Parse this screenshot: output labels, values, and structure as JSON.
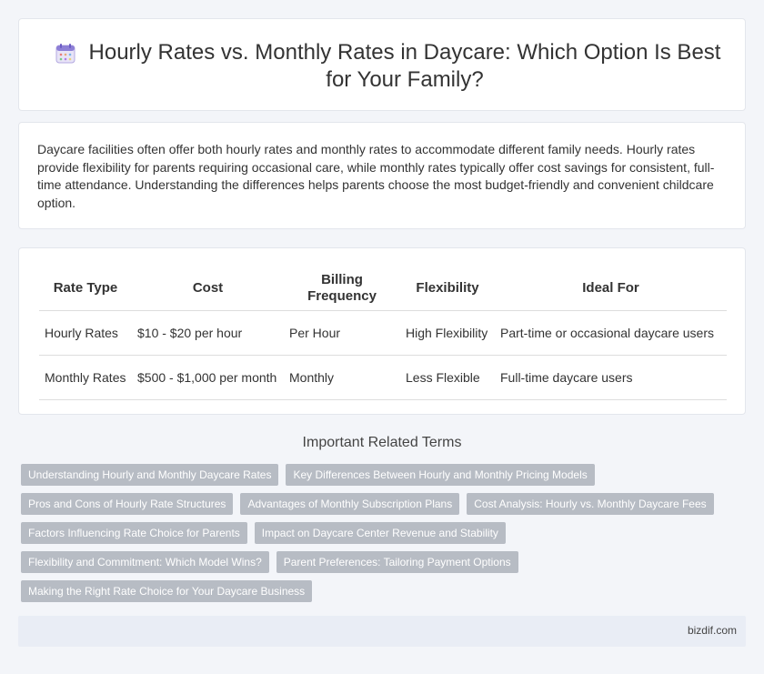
{
  "header": {
    "title": "Hourly Rates vs. Monthly Rates in Daycare: Which Option Is Best for Your Family?",
    "icon": "calendar-icon"
  },
  "intro": {
    "text": "Daycare facilities often offer both hourly rates and monthly rates to accommodate different family needs. Hourly rates provide flexibility for parents requiring occasional care, while monthly rates typically offer cost savings for consistent, full-time attendance. Understanding the differences helps parents choose the most budget-friendly and convenient childcare option."
  },
  "table": {
    "headers": [
      "Rate Type",
      "Cost",
      "Billing Frequency",
      "Flexibility",
      "Ideal For"
    ],
    "rows": [
      [
        "Hourly Rates",
        "$10 - $20 per hour",
        "Per Hour",
        "High Flexibility",
        "Part-time or occasional daycare users"
      ],
      [
        "Monthly Rates",
        "$500 - $1,000 per month",
        "Monthly",
        "Less Flexible",
        "Full-time daycare users"
      ]
    ]
  },
  "related": {
    "title": "Important Related Terms",
    "tags": [
      "Understanding Hourly and Monthly Daycare Rates",
      "Key Differences Between Hourly and Monthly Pricing Models",
      "Pros and Cons of Hourly Rate Structures",
      "Advantages of Monthly Subscription Plans",
      "Cost Analysis: Hourly vs. Monthly Daycare Fees",
      "Factors Influencing Rate Choice for Parents",
      "Impact on Daycare Center Revenue and Stability",
      "Flexibility and Commitment: Which Model Wins?",
      "Parent Preferences: Tailoring Payment Options",
      "Making the Right Rate Choice for Your Daycare Business"
    ]
  },
  "footer": {
    "site": "bizdif.com"
  }
}
